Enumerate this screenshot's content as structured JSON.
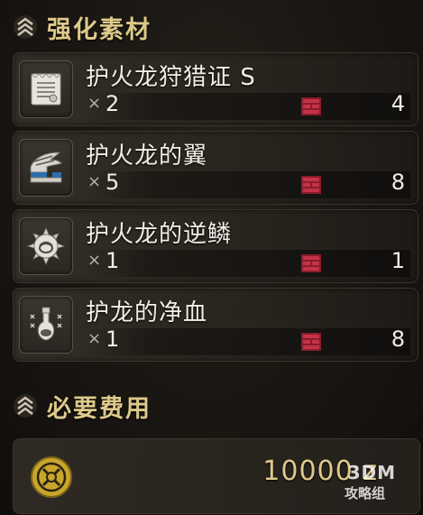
{
  "sections": {
    "materials_title": "强化素材",
    "cost_title": "必要费用"
  },
  "materials": [
    {
      "name": "护火龙狩猎证 S",
      "x_symbol": "×",
      "need": "2",
      "owned": "4",
      "icon": "ticket-scroll-icon"
    },
    {
      "name": "护火龙的翼",
      "x_symbol": "×",
      "need": "5",
      "owned": "8",
      "icon": "wing-icon"
    },
    {
      "name": "护火龙的逆鳞",
      "x_symbol": "×",
      "need": "1",
      "owned": "1",
      "icon": "gem-scale-icon"
    },
    {
      "name": "护龙的净血",
      "x_symbol": "×",
      "need": "1",
      "owned": "8",
      "icon": "blood-flask-icon"
    }
  ],
  "cost": {
    "value": "10000 z",
    "icon": "zenny-coin-icon"
  },
  "watermark": {
    "brand": "3DM",
    "sub": "攻略组"
  },
  "colors": {
    "title_gold": "#ddc98a",
    "box_red": "#b2233a",
    "text_white": "#f2efe8"
  }
}
